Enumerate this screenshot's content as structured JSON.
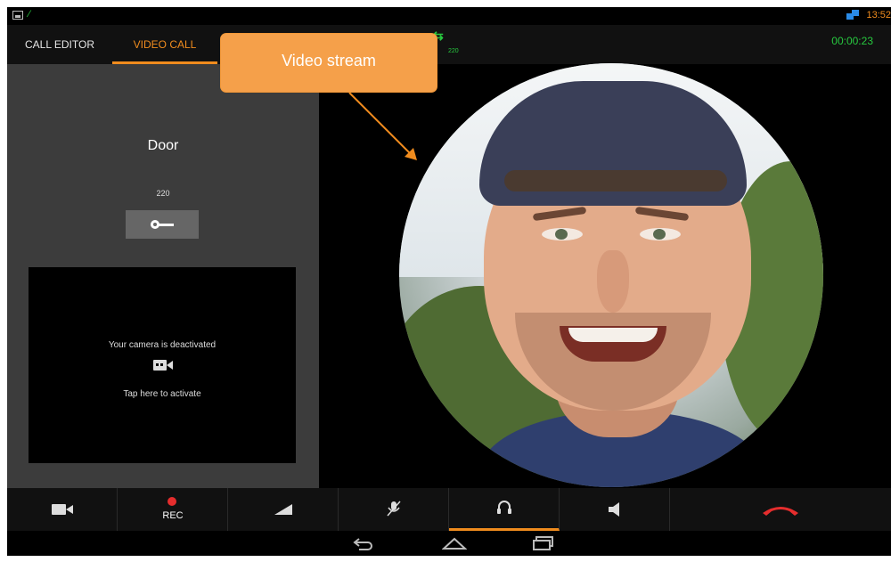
{
  "status_bar": {
    "left_icons": [
      "image-icon",
      "phone-call-icon"
    ],
    "right_icon": "network-icon",
    "time": "13:52"
  },
  "header": {
    "tabs": [
      {
        "label": "CALL EDITOR",
        "active": false
      },
      {
        "label": "VIDEO CALL",
        "active": true
      }
    ],
    "connection_icon": "call-connected-icon",
    "connection_number": "220",
    "timer": "00:00:23"
  },
  "left_panel": {
    "door_title": "Door",
    "door_number": "220",
    "key_button_icon": "key-icon",
    "camera_deactivated_text": "Your camera is deactivated",
    "camera_icon": "video-camera-icon",
    "camera_activate_text": "Tap here to activate"
  },
  "video": {
    "callout_label": "Video stream"
  },
  "toolbar": {
    "buttons": [
      {
        "icon": "video-camera-icon",
        "label": ""
      },
      {
        "icon": "record-dot-icon",
        "label": "REC"
      },
      {
        "icon": "volume-slider-icon",
        "label": ""
      },
      {
        "icon": "mic-muted-icon",
        "label": ""
      },
      {
        "icon": "headset-icon",
        "label": "",
        "active": true
      },
      {
        "icon": "speaker-icon",
        "label": ""
      },
      {
        "icon": "end-call-icon",
        "label": ""
      }
    ],
    "accent_color": "#f08c1e",
    "end_call_color": "#e52d2d"
  },
  "nav_bar": {
    "buttons": [
      "back-icon",
      "home-icon",
      "recent-apps-icon"
    ]
  }
}
